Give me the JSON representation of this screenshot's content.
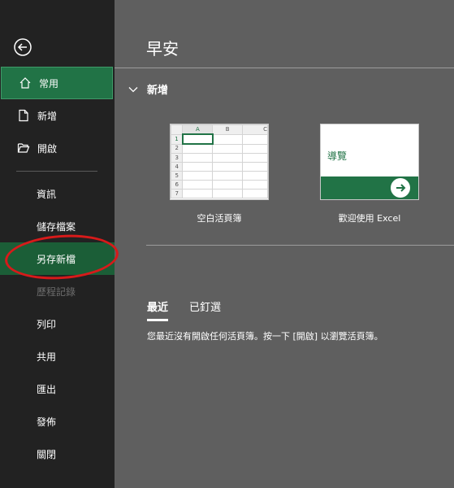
{
  "sidebar": {
    "back_icon": "arrow-left-circle-icon",
    "items": [
      {
        "label": "常用",
        "icon": "home-icon"
      },
      {
        "label": "新增",
        "icon": "new-document-icon"
      },
      {
        "label": "開啟",
        "icon": "open-folder-icon"
      }
    ],
    "text_items": [
      {
        "label": "資訊"
      },
      {
        "label": "儲存檔案"
      },
      {
        "label": "另存新檔"
      },
      {
        "label": "歷程記錄"
      },
      {
        "label": "列印"
      },
      {
        "label": "共用"
      },
      {
        "label": "匯出"
      },
      {
        "label": "發佈"
      },
      {
        "label": "關閉"
      }
    ]
  },
  "main": {
    "greeting": "早安",
    "new_section": {
      "title": "新增",
      "templates": [
        {
          "label": "空白活頁簿",
          "columns": [
            "A",
            "B",
            "C"
          ],
          "rows": [
            "1",
            "2",
            "3",
            "4",
            "5",
            "6",
            "7"
          ]
        },
        {
          "label": "歡迎使用 Excel",
          "thumb_title": "導覽"
        }
      ]
    },
    "tabs": [
      {
        "label": "最近"
      },
      {
        "label": "已釘選"
      }
    ],
    "empty_message": "您最近沒有開啟任何活頁簿。按一下 [開啟] 以瀏覽活頁簿。"
  },
  "colors": {
    "accent": "#217346",
    "selected_item": "#1b5e37",
    "annotation_oval": "#d71a1a",
    "sidebar_bg": "#222222",
    "main_bg": "#5f5f5f"
  }
}
